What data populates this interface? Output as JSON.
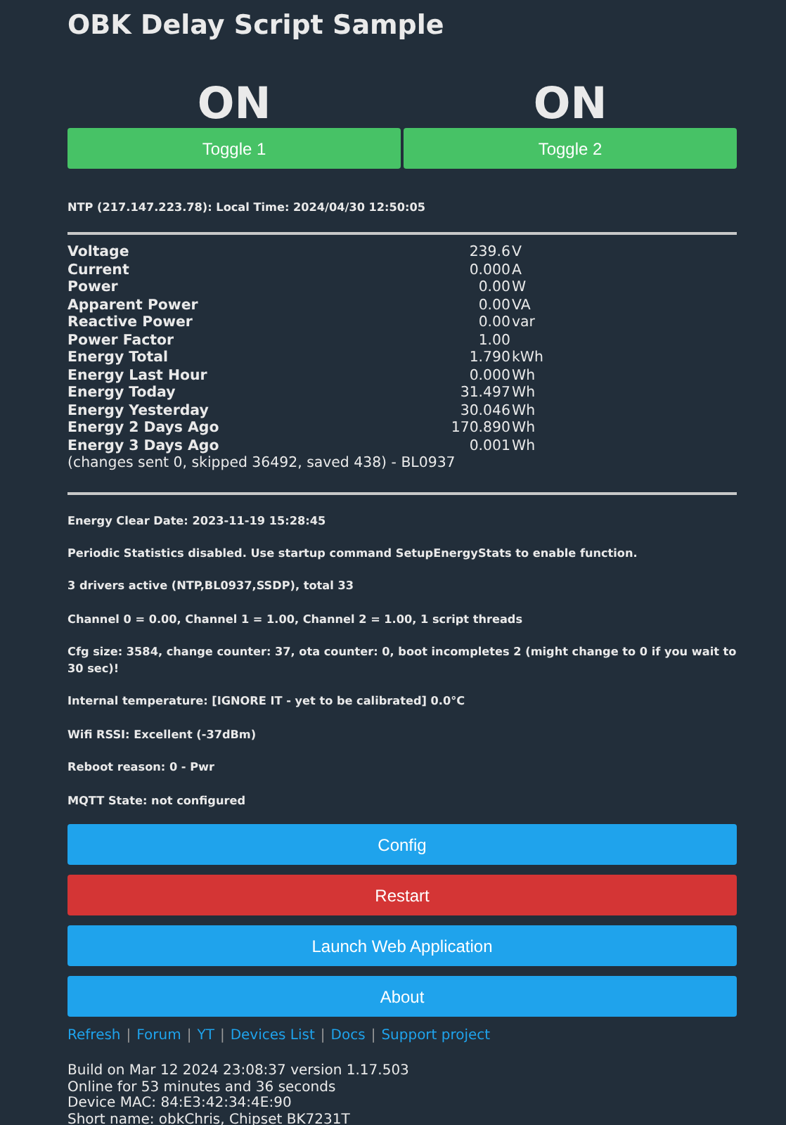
{
  "title": "OBK Delay Script Sample",
  "relays": [
    {
      "state": "ON",
      "button": "Toggle 1",
      "on": true
    },
    {
      "state": "ON",
      "button": "Toggle 2",
      "on": true
    }
  ],
  "ntp": "NTP (217.147.223.78): Local Time: 2024/04/30 12:50:05",
  "energy": [
    {
      "label": "Voltage",
      "value": "239.6",
      "unit": "V"
    },
    {
      "label": "Current",
      "value": "0.000",
      "unit": "A"
    },
    {
      "label": "Power",
      "value": "0.00",
      "unit": "W"
    },
    {
      "label": "Apparent Power",
      "value": "0.00",
      "unit": "VA"
    },
    {
      "label": "Reactive Power",
      "value": "0.00",
      "unit": "var"
    },
    {
      "label": "Power Factor",
      "value": "1.00"
    },
    {
      "label": "Energy Total",
      "value": "1.790",
      "unit": "kWh"
    },
    {
      "label": "Energy Last Hour",
      "value": "0.000",
      "unit": "Wh"
    },
    {
      "label": "Energy Today",
      "value": "31.497",
      "unit": "Wh"
    },
    {
      "label": "Energy Yesterday",
      "value": "30.046",
      "unit": "Wh"
    },
    {
      "label": "Energy 2 Days Ago",
      "value": "170.890",
      "unit": "Wh"
    },
    {
      "label": "Energy 3 Days Ago",
      "value": "0.001",
      "unit": "Wh"
    }
  ],
  "energy_note": "(changes sent 0, skipped 36492, saved 438) - BL0937",
  "info": [
    "Energy Clear Date: 2023-11-19 15:28:45",
    "Periodic Statistics disabled. Use startup command SetupEnergyStats to enable function.",
    "3 drivers active (NTP,BL0937,SSDP), total 33",
    "Channel 0 = 0.00, Channel 1 = 1.00, Channel 2 = 1.00, 1 script threads",
    "Cfg size: 3584, change counter: 37, ota counter: 0, boot incompletes 2 (might change to 0 if you wait to 30 sec)!",
    "Internal temperature: [IGNORE IT - yet to be calibrated] 0.0°C",
    "Wifi RSSI: Excellent (-37dBm)",
    "Reboot reason: 0 - Pwr",
    "MQTT State: not configured"
  ],
  "buttons": [
    {
      "label": "Config",
      "kind": "primary"
    },
    {
      "label": "Restart",
      "kind": "danger"
    },
    {
      "label": "Launch Web Application",
      "kind": "primary"
    },
    {
      "label": "About",
      "kind": "primary"
    }
  ],
  "links": [
    "Refresh",
    "Forum",
    "YT",
    "Devices List",
    "Docs",
    "Support project"
  ],
  "link_separator": "|",
  "footer": [
    "Build on Mar 12 2024 23:08:37 version 1.17.503",
    "Online for 53 minutes and 36 seconds",
    "Device MAC: 84:E3:42:34:4E:90",
    "Short name: obkChris, Chipset BK7231T"
  ]
}
